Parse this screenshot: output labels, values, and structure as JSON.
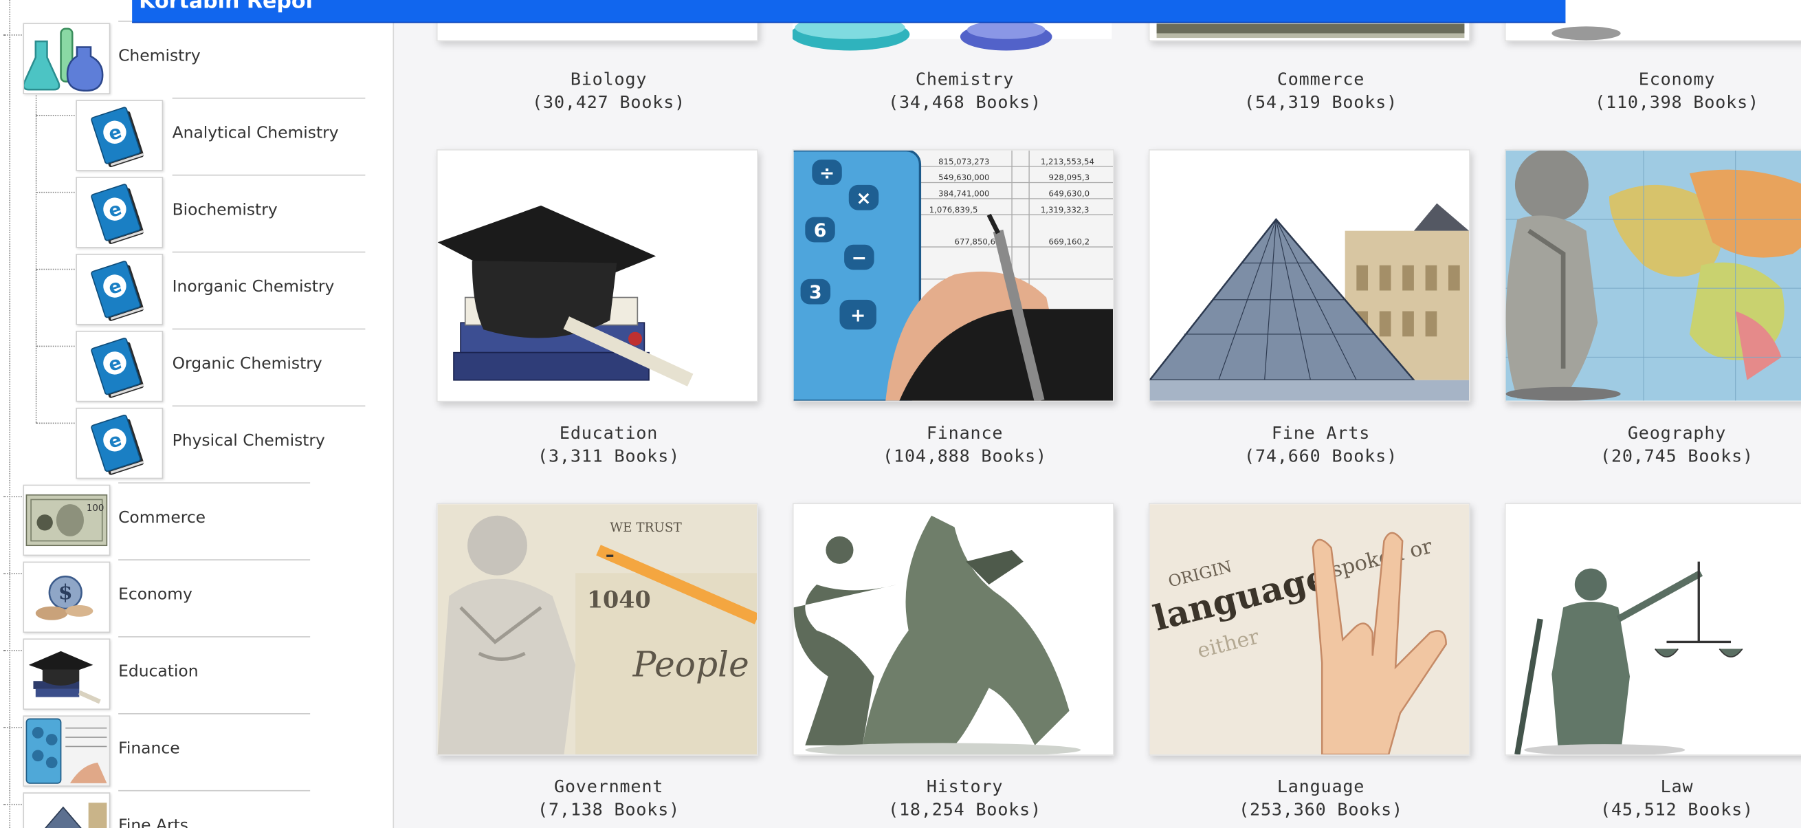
{
  "banner": {
    "title": "Kortabln Repol"
  },
  "sidebar": {
    "items": [
      {
        "label": "Chemistry",
        "level": 1,
        "icon": "chemistry-flasks-icon"
      },
      {
        "label": "Analytical Chemistry",
        "level": 2,
        "icon": "ebook-icon"
      },
      {
        "label": "Biochemistry",
        "level": 2,
        "icon": "ebook-icon"
      },
      {
        "label": "Inorganic Chemistry",
        "level": 2,
        "icon": "ebook-icon"
      },
      {
        "label": "Organic Chemistry",
        "level": 2,
        "icon": "ebook-icon"
      },
      {
        "label": "Physical Chemistry",
        "level": 2,
        "icon": "ebook-icon"
      },
      {
        "label": "Commerce",
        "level": 1,
        "icon": "dollar-bill-icon"
      },
      {
        "label": "Economy",
        "level": 1,
        "icon": "economy-icon"
      },
      {
        "label": "Education",
        "level": 1,
        "icon": "graduation-cap-icon"
      },
      {
        "label": "Finance",
        "level": 1,
        "icon": "calculator-icon"
      },
      {
        "label": "Fine Arts",
        "level": 1,
        "icon": "pyramid-icon"
      }
    ]
  },
  "grid": {
    "tiles": [
      {
        "name": "Biology",
        "count": "(30,427 Books)"
      },
      {
        "name": "Chemistry",
        "count": "(34,468 Books)"
      },
      {
        "name": "Commerce",
        "count": "(54,319 Books)"
      },
      {
        "name": "Economy",
        "count": "(110,398 Books)"
      },
      {
        "name": "Education",
        "count": "(3,311 Books)"
      },
      {
        "name": "Finance",
        "count": "(104,888 Books)"
      },
      {
        "name": "Fine Arts",
        "count": "(74,660 Books)"
      },
      {
        "name": "Geography",
        "count": "(20,745 Books)"
      },
      {
        "name": "Government",
        "count": "(7,138 Books)"
      },
      {
        "name": "History",
        "count": "(18,254 Books)"
      },
      {
        "name": "Language",
        "count": "(253,360 Books)"
      },
      {
        "name": "Law",
        "count": "(45,512 Books)"
      }
    ],
    "image_texts": {
      "finance_numbers": [
        "815,073,273",
        "549,630,000",
        "384,741,000",
        "1,076,839,5",
        "677,850,6",
        "1,213,553,54",
        "928,095,3",
        "649,630,0",
        "1,319,332,3",
        "669,160,2"
      ],
      "government_text": [
        "WE TRUST",
        "1040",
        "People"
      ],
      "language_text": [
        "ORIGIN",
        "language",
        "either",
        "spoken or"
      ]
    }
  },
  "colors": {
    "banner": "#1166ee",
    "ebook": "#1a7fc4",
    "background": "#f5f5f7"
  }
}
